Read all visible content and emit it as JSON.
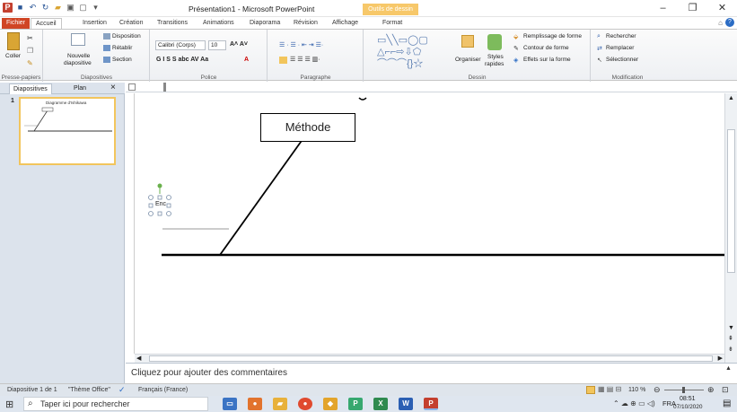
{
  "window": {
    "title": "Présentation1 - Microsoft PowerPoint",
    "context_tab": "Outils de dessin",
    "logo_letter": "P"
  },
  "tabs": {
    "file": "Fichier",
    "home": "Accueil",
    "insert": "Insertion",
    "design": "Création",
    "transitions": "Transitions",
    "animations": "Animations",
    "slideshow": "Diaporama",
    "review": "Révision",
    "view": "Affichage",
    "format": "Format"
  },
  "ribbon": {
    "clipboard": {
      "paste": "Coller",
      "label": "Presse-papiers"
    },
    "slides": {
      "new_slide_1": "Nouvelle",
      "new_slide_2": "diapositive",
      "layout": "Disposition",
      "reset": "Rétablir",
      "section": "Section",
      "label": "Diapositives"
    },
    "font": {
      "name": "Calibri (Corps)",
      "size": "10",
      "label": "Police"
    },
    "paragraph": {
      "label": "Paragraphe"
    },
    "drawing": {
      "arrange": "Organiser",
      "styles_1": "Styles",
      "styles_2": "rapides",
      "fill": "Remplissage de forme",
      "outline": "Contour de forme",
      "effects": "Effets sur la forme",
      "label": "Dessin"
    },
    "editing": {
      "find": "Rechercher",
      "replace": "Remplacer",
      "select": "Sélectionner",
      "label": "Modification"
    }
  },
  "leftpanel": {
    "tab_slides": "Diapositives",
    "tab_outline": "Plan",
    "close": "×",
    "slide_number": "1",
    "thumb_title": "Diagramme d'Ishikawa"
  },
  "slide": {
    "box_method": "Méthode",
    "small_text": "Enc"
  },
  "notes": {
    "placeholder": "Cliquez pour ajouter des commentaires"
  },
  "status": {
    "slide": "Diapositive 1 de 1",
    "theme": "\"Thème Office\"",
    "language": "Français (France)",
    "zoom": "110 %"
  },
  "taskbar": {
    "search_placeholder": "Taper ici pour rechercher",
    "lang": "FRA",
    "time": "08:51",
    "date": "07/10/2020"
  },
  "colors": {
    "file_tab": "#d04525",
    "context_tab": "#f7c86a",
    "selection_handle": "#6ab04c",
    "thumb_border": "#f2c55c"
  }
}
